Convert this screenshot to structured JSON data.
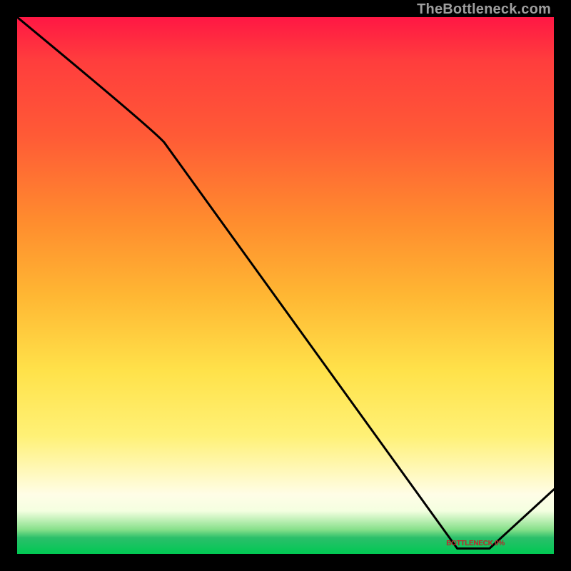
{
  "watermark": "TheBottleneck.com",
  "marker_label": "BOTTLENECK 0%",
  "chart_data": {
    "type": "line",
    "title": "",
    "xlabel": "",
    "ylabel": "",
    "xlim": [
      0,
      100
    ],
    "ylim": [
      0,
      100
    ],
    "series": [
      {
        "name": "bottleneck-curve",
        "x": [
          0,
          25,
          82,
          88,
          100
        ],
        "values": [
          100,
          78,
          1,
          1,
          12
        ]
      }
    ],
    "marker": {
      "x_range": [
        82,
        88
      ],
      "y": 1,
      "label": "BOTTLENECK 0%"
    },
    "background_gradient": {
      "top_color": "#ff1744",
      "mid_colors": [
        "#ff8c2e",
        "#ffe24a",
        "#fffde7"
      ],
      "bottom_color": "#00c853"
    }
  }
}
